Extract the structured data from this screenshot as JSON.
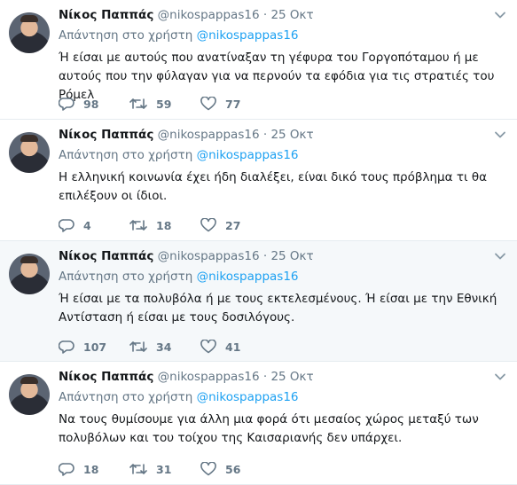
{
  "tweets": [
    {
      "name": "Νίκος Παππάς",
      "handle": "@nikospappas16",
      "dot": "·",
      "time": "25 Οκτ",
      "replying_prefix": "Απάντηση στο χρήστη",
      "replying_to": "@nikospappas16",
      "text": "Ή είσαι με αυτούς που ανατίναξαν τη γέφυρα του Γοργοπόταμου ή με αυτούς που την φύλαγαν για να περνούν τα εφόδια για τις στρατιές του Ρόμελ",
      "replies": "98",
      "retweets": "59",
      "likes": "77",
      "highlighted": false
    },
    {
      "name": "Νίκος Παππάς",
      "handle": "@nikospappas16",
      "dot": "·",
      "time": "25 Οκτ",
      "replying_prefix": "Απάντηση στο χρήστη",
      "replying_to": "@nikospappas16",
      "text": "Η ελληνική κοινωνία έχει ήδη διαλέξει, είναι δικό τους πρόβλημα τι θα επιλέξουν οι ίδιοι.",
      "replies": "4",
      "retweets": "18",
      "likes": "27",
      "highlighted": false
    },
    {
      "name": "Νίκος Παππάς",
      "handle": "@nikospappas16",
      "dot": "·",
      "time": "25 Οκτ",
      "replying_prefix": "Απάντηση στο χρήστη",
      "replying_to": "@nikospappas16",
      "text": "Ή είσαι με τα πολυβόλα ή με τους εκτελεσμένους. Ή είσαι με την Εθνική Αντίσταση ή είσαι με τους δοσιλόγους.",
      "replies": "107",
      "retweets": "34",
      "likes": "41",
      "highlighted": true
    },
    {
      "name": "Νίκος Παππάς",
      "handle": "@nikospappas16",
      "dot": "·",
      "time": "25 Οκτ",
      "replying_prefix": "Απάντηση στο χρήστη",
      "replying_to": "@nikospappas16",
      "text": "Να τους θυμίσουμε για άλλη μια φορά ότι μεσαίος χώρος μεταξύ των πολυβόλων και του τοίχου της Καισαριανής δεν υπάρχει.",
      "replies": "18",
      "retweets": "31",
      "likes": "56",
      "highlighted": false
    }
  ],
  "colors": {
    "link": "#1da1f2",
    "muted": "#657786",
    "highlight_bg": "#f5f8fa",
    "border": "#e6ecf0"
  },
  "icons": {
    "reply": "reply-icon",
    "retweet": "retweet-icon",
    "like": "heart-icon",
    "more": "chevron-down-icon"
  }
}
